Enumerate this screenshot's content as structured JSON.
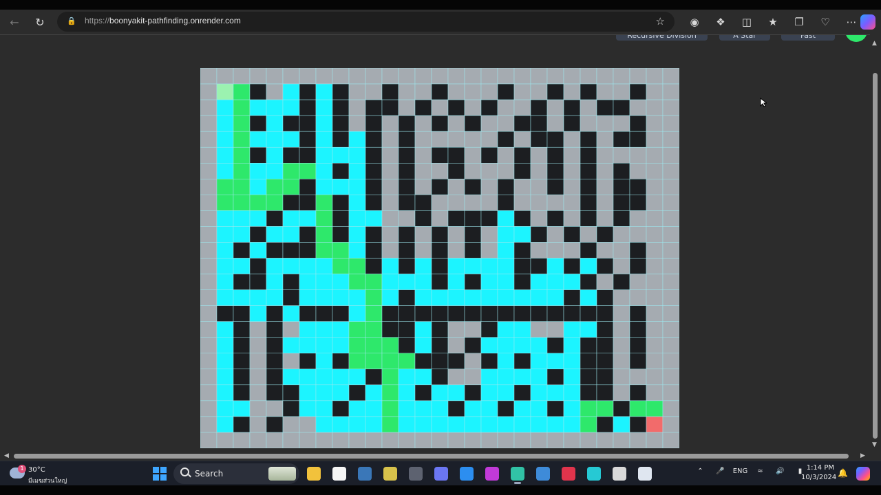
{
  "browser": {
    "url_origin": "https://",
    "url_host": "boonyakit-pathfinding.onrender.com",
    "icons": [
      "back-arrow-icon",
      "refresh-icon",
      "lock-icon",
      "favorite-star-icon",
      "tracking-icon",
      "extensions-icon",
      "split-screen-icon",
      "favorites-icon",
      "collections-icon",
      "browser-essentials-icon",
      "more-icon",
      "copilot-icon"
    ]
  },
  "app": {
    "buttons": [
      "Recursive Division",
      "A Star",
      "Fast"
    ]
  },
  "maze": {
    "rows": 24,
    "cols": 29,
    "colors": {
      "wall": "#1c1e21",
      "empty": "#a5abb1",
      "visited": "#1cf4ff",
      "path": "#2ee86b",
      "start": "#9bf2b0",
      "end": "#f26b6b",
      "gridline": "#9de8ef"
    },
    "grid": [
      "BBBBBBBBBBBBBBBBBBBBBBBBBBBBB",
      "BSGBWVBVBWWBWWBWWWBWWBWBWWBWB",
      "BVGVVVBVBWBBWBWBWBWWBWBWBBWWB",
      "BVGBVBBVBWBWBWBWBWWBBWBWWWBWB",
      "BVGVVVBVBVBWBWWWWWBWBBWBWBBWB",
      "BVGBVBBVVVBWBWBBWBWBWBWBWWWWB",
      "BVGVVGGVBVBWBWWBWWWBWBWBWBWWB",
      "BGGVGGBVVVBWBWBWBWBWWBWBWBBWB",
      "BGGGGBBGBVBWBBWWWWBWWWWBWBBWB",
      "BVVVBVVGBVVWWBWBBBVBWBWBWBWWB",
      "BVVBVVBGBVBWBWBWBWVVBWBWBWWWB",
      "BVBVBBBGGVBWBWBWBWVBWWWBWWBWB",
      "BVVBVVVVGGBVBVBVVVVBBVBVBWBWB",
      "BVBBVBVVVGGVVVBVBVVBVVVBWBWWB",
      "BVVVVBVVVVGVBVVVVVVVVVBVBWWWB",
      "BBBVBVBBBVGBBBBBBBBBBBBBBWBWB",
      "BVBWBWVVVGGBBVBWWBVVWWVVBWBWB",
      "BVBWBVVVVGGGBVBWBVVVVBVBBWBWB",
      "BVBWBWBVBGGGGBBBWBVBVVVBBWBWB",
      "BVBWBVVVVVBGVVBWWVVVVBVBBWWWB",
      "BVBWBBVVVBVGVBVVBVVBVVVBBWBWB",
      "BVVWWBVVBVVGVVVBVVBVVBVGGBGGB",
      "BVBWBWWVVVVGVVVVVVVVVVVGBVBGB",
      "BBBBBBBBBBBBBBBBBBBBBBBBBBBBB"
    ]
  },
  "taskbar": {
    "weather_temp": "30°C",
    "weather_desc": "มีเมฆส่วนใหญ่",
    "weather_badge": "1",
    "search_label": "Search",
    "lang": "ENG",
    "time": "1:14 PM",
    "date": "10/3/2024",
    "apps": [
      {
        "name": "file-explorer-icon",
        "color": "#f2c23c",
        "active": false
      },
      {
        "name": "unreal-engine-icon",
        "color": "#f5f5f5",
        "active": false
      },
      {
        "name": "steam-icon",
        "color": "#3a77b8",
        "active": false
      },
      {
        "name": "git-icon",
        "color": "#d8c24b",
        "active": false
      },
      {
        "name": "terminal-icon",
        "color": "#5d6270",
        "active": false
      },
      {
        "name": "discord-icon",
        "color": "#6b76f2",
        "active": false
      },
      {
        "name": "vscode-icon",
        "color": "#2c8ef0",
        "active": false
      },
      {
        "name": "jetbrains-icon",
        "color": "#c13ad8",
        "active": false
      },
      {
        "name": "edge-icon",
        "color": "#31c2a6",
        "active": true
      },
      {
        "name": "snipping-tool-icon",
        "color": "#3e8bd9",
        "active": false
      },
      {
        "name": "media-player-icon",
        "color": "#e0344c",
        "active": false
      },
      {
        "name": "vpn-icon",
        "color": "#26c9d4",
        "active": false
      },
      {
        "name": "unity-icon",
        "color": "#d9d9d9",
        "active": false
      },
      {
        "name": "notepad-icon",
        "color": "#dfe6f0",
        "active": false
      }
    ]
  }
}
